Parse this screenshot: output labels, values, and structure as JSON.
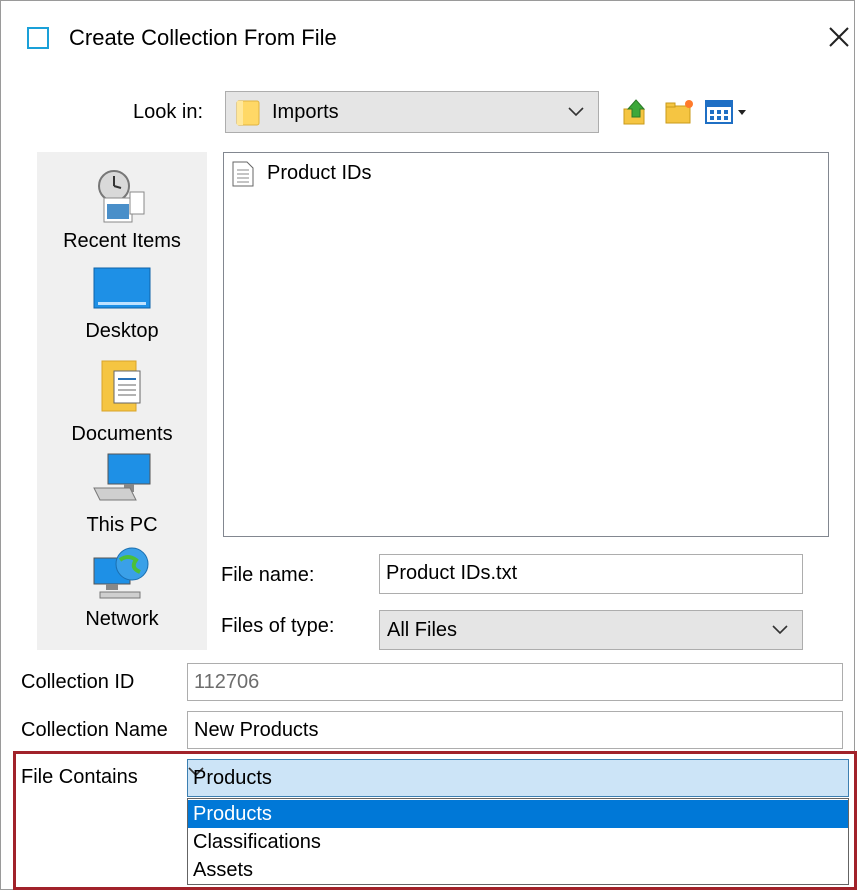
{
  "dialog": {
    "title": "Create Collection From File"
  },
  "look_in": {
    "label": "Look in:",
    "value": "Imports"
  },
  "places": [
    {
      "label": "Recent Items",
      "icon": "recent-items-icon"
    },
    {
      "label": "Desktop",
      "icon": "desktop-icon"
    },
    {
      "label": "Documents",
      "icon": "documents-icon"
    },
    {
      "label": "This PC",
      "icon": "this-pc-icon"
    },
    {
      "label": "Network",
      "icon": "network-icon"
    }
  ],
  "files": [
    {
      "name": "Product IDs",
      "icon": "text-file-icon"
    }
  ],
  "file_name": {
    "label": "File name:",
    "value": "Product IDs.txt"
  },
  "files_of_type": {
    "label": "Files of type:",
    "value": "All Files"
  },
  "collection_id": {
    "label": "Collection ID",
    "value": "112706"
  },
  "collection_name": {
    "label": "Collection Name",
    "value": "New Products"
  },
  "file_contains": {
    "label": "File Contains",
    "value": "Products",
    "options": [
      "Products",
      "Classifications",
      "Assets"
    ]
  },
  "colors": {
    "highlight_border": "#a1222a",
    "selected_option": "#0078d7",
    "combo_focus": "#cce4f7"
  }
}
